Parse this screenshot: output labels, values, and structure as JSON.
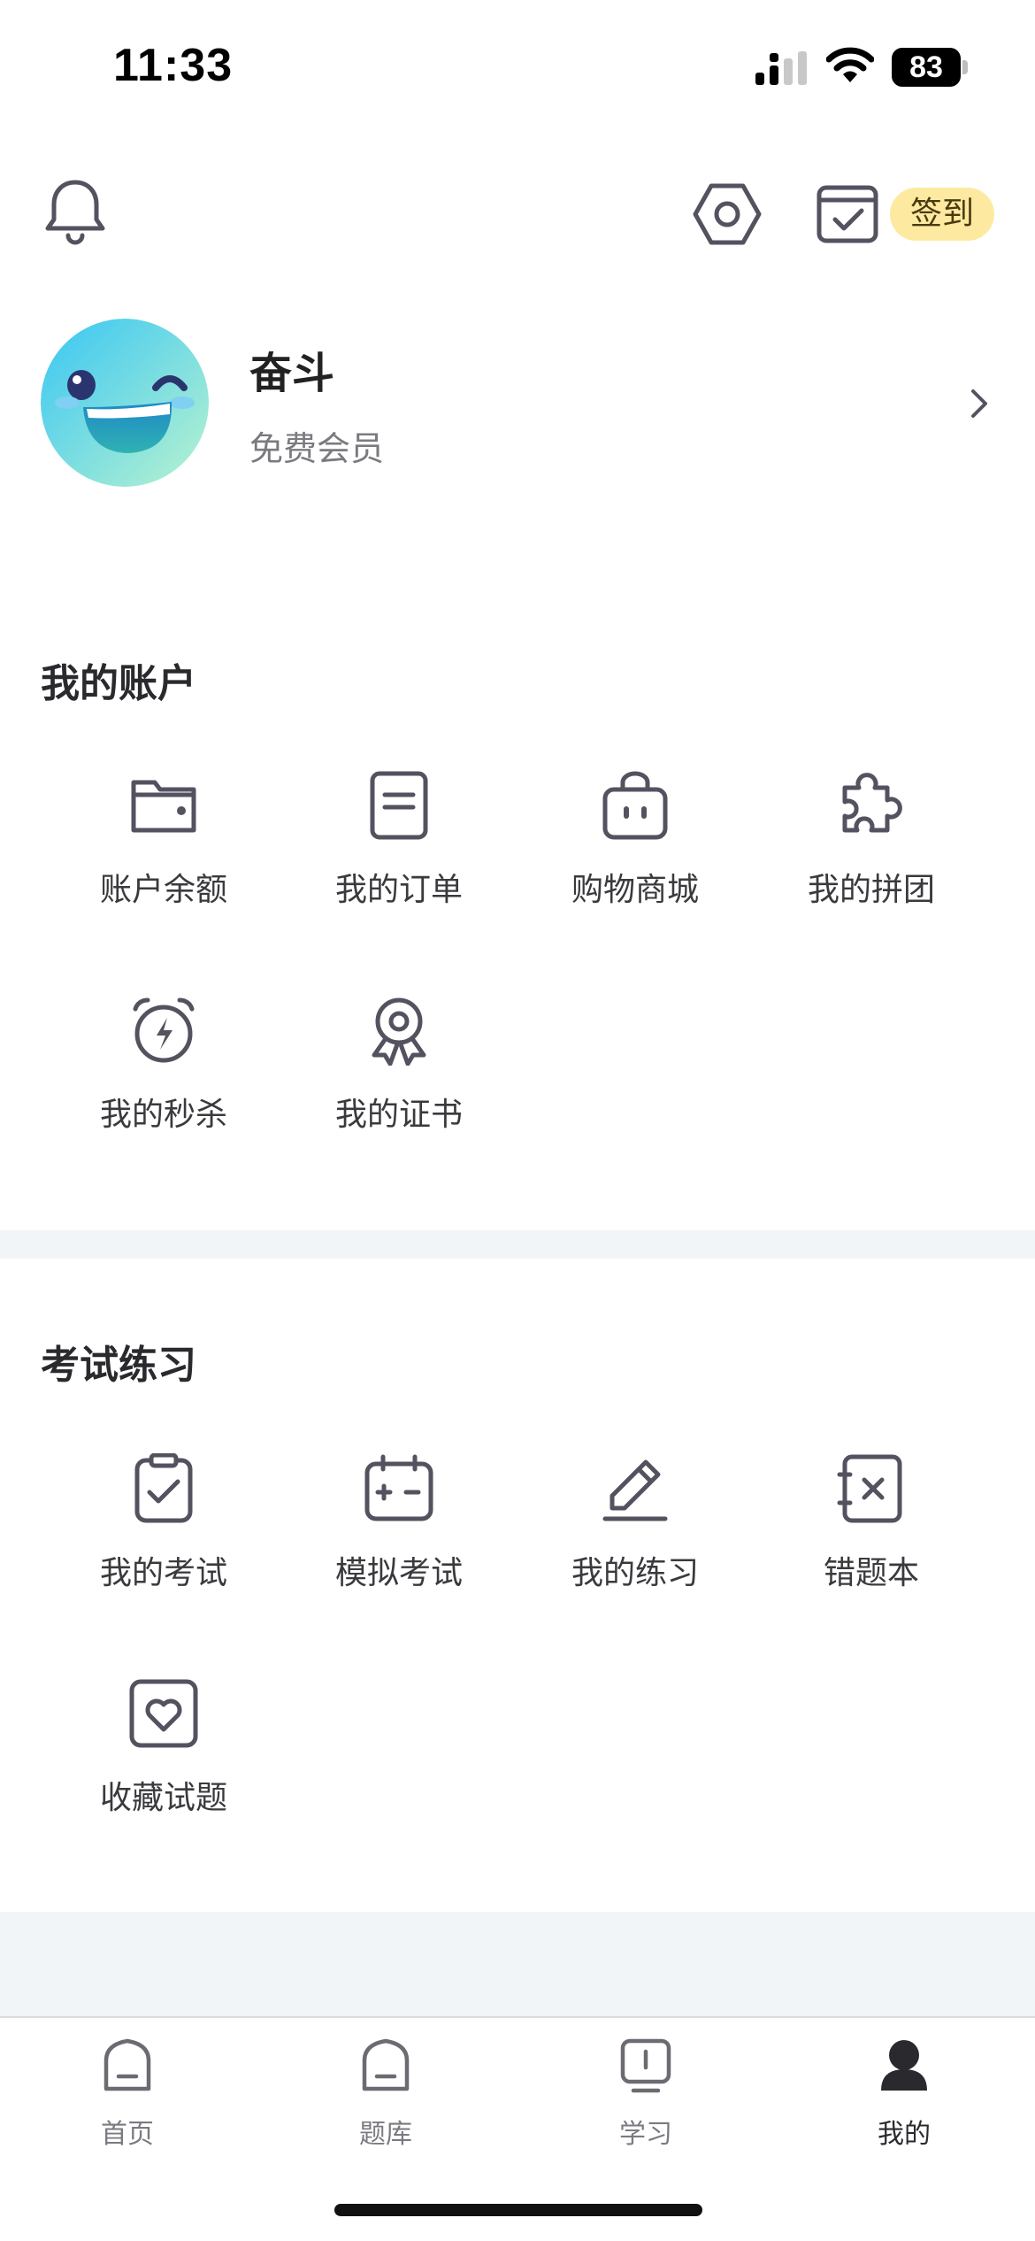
{
  "status_bar": {
    "time": "11:33",
    "battery": "83"
  },
  "header": {
    "checkin_label": "签到"
  },
  "profile": {
    "name": "奋斗",
    "tier": "免费会员"
  },
  "account_section": {
    "title": "我的账户",
    "items": [
      {
        "label": "账户余额",
        "icon": "wallet-icon"
      },
      {
        "label": "我的订单",
        "icon": "order-document-icon"
      },
      {
        "label": "购物商城",
        "icon": "shopping-bag-icon"
      },
      {
        "label": "我的拼团",
        "icon": "puzzle-icon"
      },
      {
        "label": "我的秒杀",
        "icon": "alarm-flash-icon"
      },
      {
        "label": "我的证书",
        "icon": "award-ribbon-icon"
      }
    ]
  },
  "exam_section": {
    "title": "考试练习",
    "items": [
      {
        "label": "我的考试",
        "icon": "clipboard-check-icon"
      },
      {
        "label": "模拟考试",
        "icon": "calendar-exam-icon"
      },
      {
        "label": "我的练习",
        "icon": "pencil-icon"
      },
      {
        "label": "错题本",
        "icon": "wrong-book-icon"
      },
      {
        "label": "收藏试题",
        "icon": "heart-favorite-icon"
      }
    ]
  },
  "tabs": [
    {
      "label": "首页",
      "icon": "home-icon",
      "active": false
    },
    {
      "label": "题库",
      "icon": "question-bank-icon",
      "active": false
    },
    {
      "label": "学习",
      "icon": "study-icon",
      "active": false
    },
    {
      "label": "我的",
      "icon": "profile-icon",
      "active": true
    }
  ],
  "colors": {
    "icon_stroke": "#555260",
    "checkin_bg": "#fdeaa0",
    "section_divider": "#f2f5f8",
    "avatar_gradient_start": "#38c6f4",
    "avatar_gradient_end": "#b9f3cf"
  }
}
